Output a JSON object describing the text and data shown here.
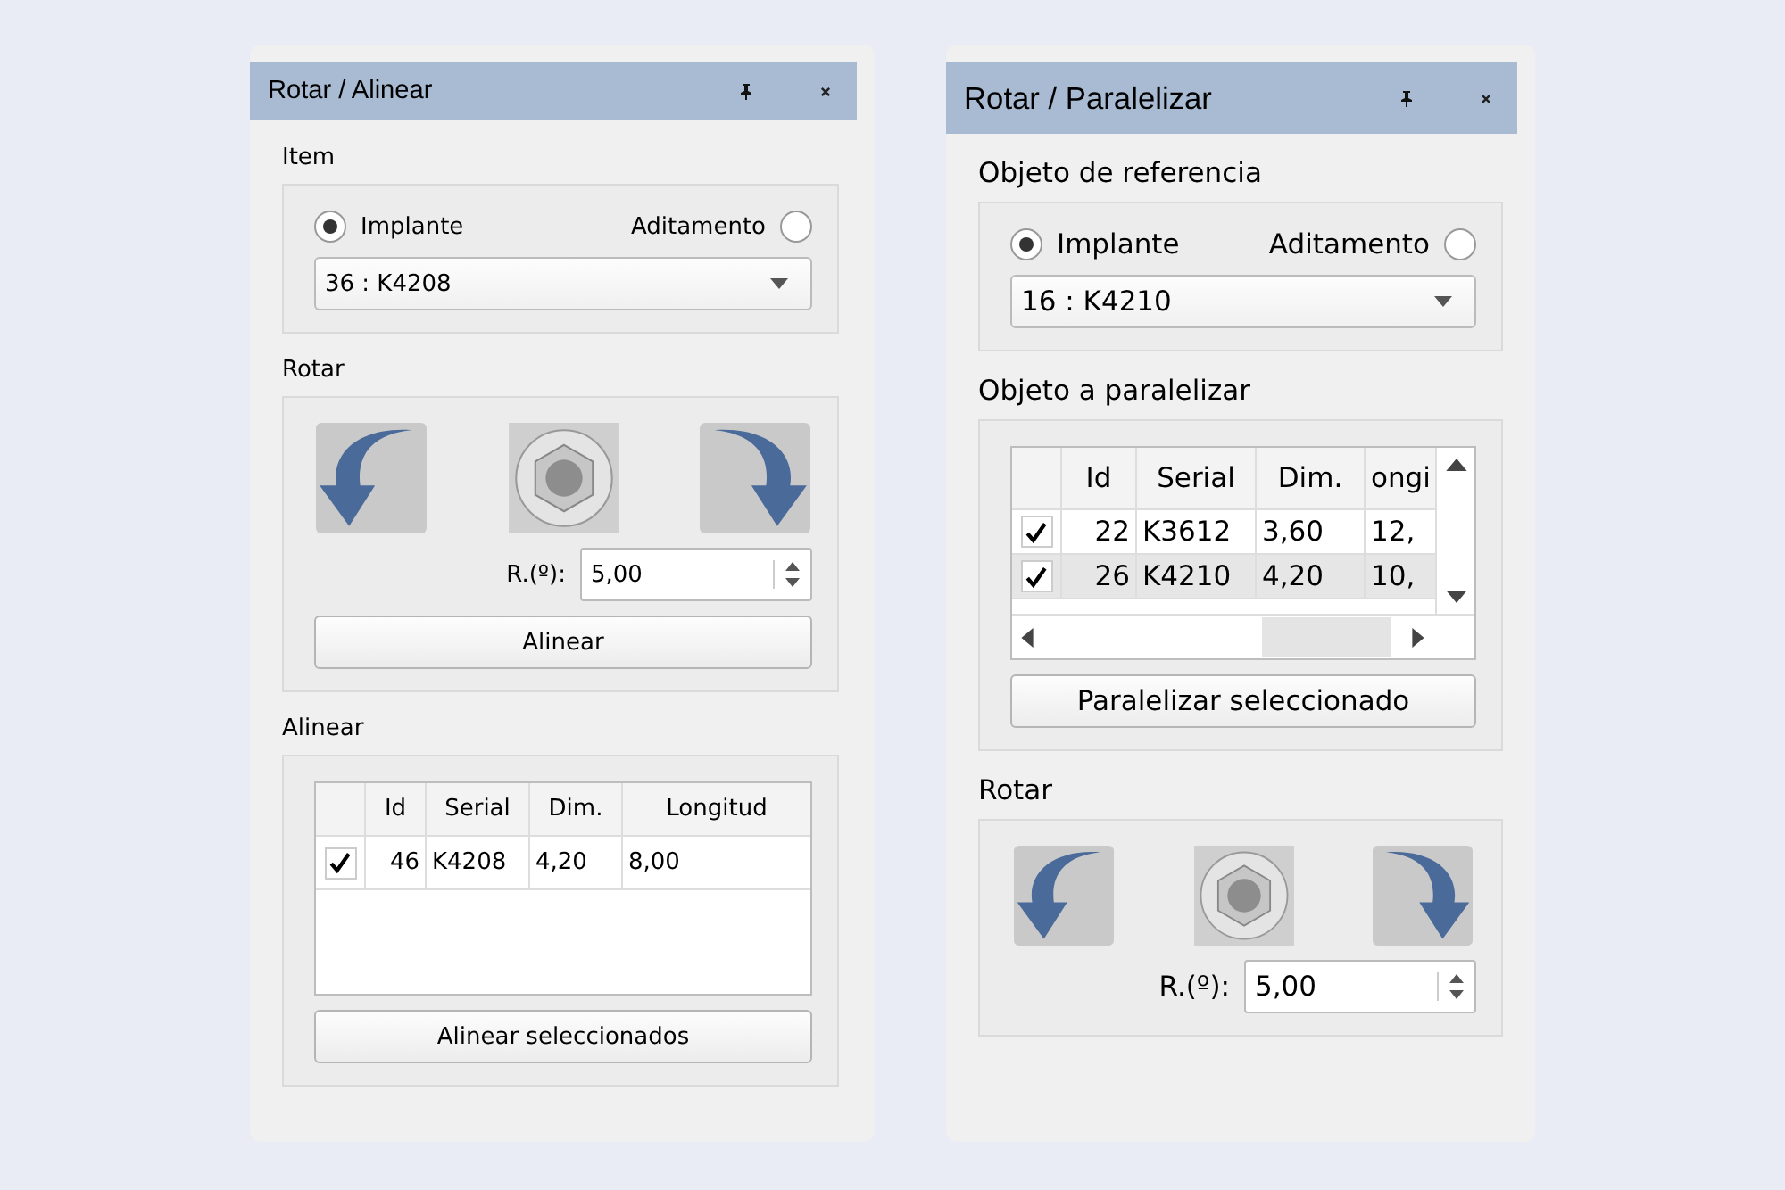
{
  "panels": [
    {
      "title": "Rotar / Alinear",
      "sections": [
        {
          "kind": "selector",
          "label": "Item",
          "radios": [
            {
              "label": "Implante",
              "selected": true
            },
            {
              "label": "Aditamento",
              "selected": false
            }
          ],
          "dropdown": "36 : K4208"
        },
        {
          "kind": "rotate",
          "label": "Rotar",
          "spin_label": "R.(º):",
          "spin_value": "5,00",
          "button": "Alinear"
        },
        {
          "kind": "table",
          "label": "Alinear",
          "columns": [
            "Id",
            "Serial",
            "Dim.",
            "Longitud"
          ],
          "scrollbars": false,
          "rows": [
            {
              "checked": true,
              "selected": false,
              "cells": [
                "46",
                "K4208",
                "4,20",
                "8,00"
              ]
            }
          ],
          "button": "Alinear seleccionados"
        }
      ]
    },
    {
      "title": "Rotar / Paralelizar",
      "sections": [
        {
          "kind": "selector",
          "label": "Objeto de referencia",
          "radios": [
            {
              "label": "Implante",
              "selected": true
            },
            {
              "label": "Aditamento",
              "selected": false
            }
          ],
          "dropdown": "16 : K4210"
        },
        {
          "kind": "table",
          "label": "Objeto a paralelizar",
          "columns": [
            "Id",
            "Serial",
            "Dim.",
            "ongi"
          ],
          "scrollbars": true,
          "rows": [
            {
              "checked": true,
              "selected": false,
              "cells": [
                "22",
                "K3612",
                "3,60",
                "12,"
              ]
            },
            {
              "checked": true,
              "selected": true,
              "cells": [
                "26",
                "K4210",
                "4,20",
                "10,"
              ]
            }
          ],
          "button": "Paralelizar seleccionado"
        },
        {
          "kind": "rotate",
          "label": "Rotar",
          "spin_label": "R.(º):",
          "spin_value": "5,00"
        }
      ]
    }
  ]
}
